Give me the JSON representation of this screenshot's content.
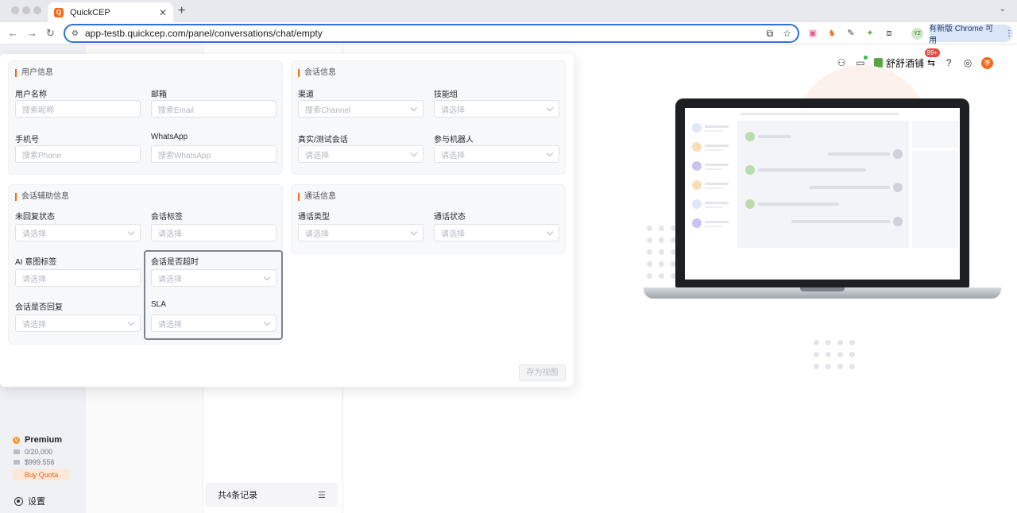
{
  "browser": {
    "tab_title": "QuickCEP",
    "tab_favicon": "Q",
    "url": "app-testb.quickcep.com/panel/conversations/chat/empty",
    "profile_initials": "YZ",
    "update_label": "有新版 Chrome 可用"
  },
  "sidebar": {
    "plan": "Premium",
    "quota_1": "0/20,000",
    "quota_2": "$999.556",
    "buy_quota": "Buy Quota",
    "settings": "设置"
  },
  "list": {
    "records": "共4条记录"
  },
  "topbar": {
    "store_name": "舒舒酒铺",
    "badge": "99+",
    "avatar": "李"
  },
  "filters": {
    "user_info": {
      "title": "用户信息",
      "name_label": "用户名称",
      "name_placeholder": "搜索昵称",
      "email_label": "邮箱",
      "email_placeholder": "搜索Email",
      "phone_label": "手机号",
      "phone_placeholder": "搜索Phone",
      "whatsapp_label": "WhatsApp",
      "whatsapp_placeholder": "搜索WhatsApp"
    },
    "session_info": {
      "title": "会话信息",
      "channel_label": "渠道",
      "channel_placeholder": "搜索Channel",
      "skill_label": "技能组",
      "skill_placeholder": "请选择",
      "real_test_label": "真实/测试会话",
      "real_test_placeholder": "请选择",
      "bot_label": "参与机器人",
      "bot_placeholder": "请选择"
    },
    "assist_info": {
      "title": "会话辅助信息",
      "unreplied_label": "未回复状态",
      "unreplied_placeholder": "请选择",
      "tag_label": "会话标签",
      "tag_placeholder": "请选择",
      "ai_tag_label": "AI 意图标签",
      "ai_tag_placeholder": "请选择",
      "timeout_label": "会话是否超时",
      "timeout_placeholder": "请选择",
      "replied_label": "会话是否回复",
      "replied_placeholder": "请选择",
      "sla_label": "SLA",
      "sla_placeholder": "请选择"
    },
    "call_info": {
      "title": "通话信息",
      "call_type_label": "通话类型",
      "call_type_placeholder": "请选择",
      "call_status_label": "通话状态",
      "call_status_placeholder": "请选择"
    },
    "save_view": "存为视图"
  },
  "colors": {
    "accent": "#f26b1d",
    "url_border": "#2f6fde"
  }
}
